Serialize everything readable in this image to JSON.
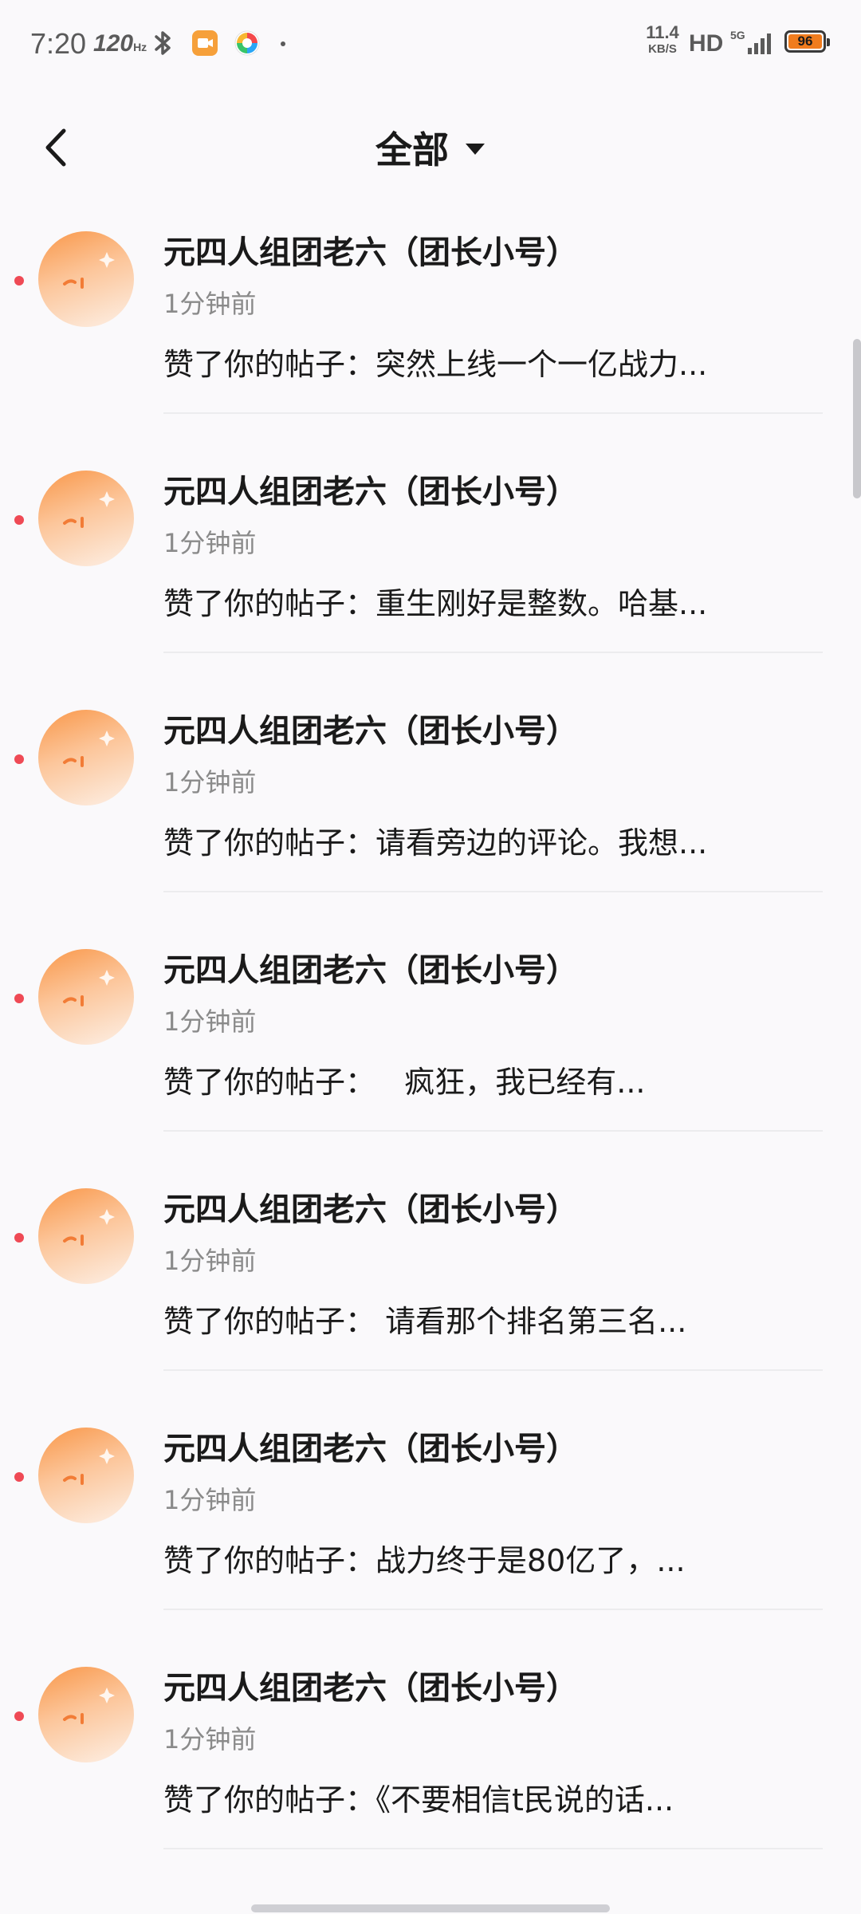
{
  "status_bar": {
    "time": "7:20",
    "refresh_rate": "120",
    "refresh_unit": "Hz",
    "net_speed_value": "11.4",
    "net_speed_unit": "KB/S",
    "hd_label": "HD",
    "network_type": "5G",
    "battery_level": "96",
    "battery_color": "#f07c1e",
    "icons": [
      "bluetooth-icon",
      "screen-record-icon",
      "app-icon",
      "signal-icon",
      "battery-icon"
    ]
  },
  "header": {
    "title": "全部",
    "back_icon": "chevron-left-icon",
    "filter_icon": "caret-down-icon"
  },
  "notifications": [
    {
      "name": "元四人组团老六（团长小号）",
      "time": "1分钟前",
      "message": "赞了你的帖子：突然上线一个一亿战力..."
    },
    {
      "name": "元四人组团老六（团长小号）",
      "time": "1分钟前",
      "message": "赞了你的帖子：重生刚好是整数。哈基..."
    },
    {
      "name": "元四人组团老六（团长小号）",
      "time": "1分钟前",
      "message": "赞了你的帖子：请看旁边的评论。我想..."
    },
    {
      "name": "元四人组团老六（团长小号）",
      "time": "1分钟前",
      "message": "赞了你的帖子：   疯狂，我已经有..."
    },
    {
      "name": "元四人组团老六（团长小号）",
      "time": "1分钟前",
      "message": "赞了你的帖子： 请看那个排名第三名..."
    },
    {
      "name": "元四人组团老六（团长小号）",
      "time": "1分钟前",
      "message": "赞了你的帖子：战力终于是80亿了，..."
    },
    {
      "name": "元四人组团老六（团长小号）",
      "time": "1分钟前",
      "message": "赞了你的帖子：《不要相信t民说的话..."
    }
  ],
  "colors": {
    "unread_dot": "#ef4a55",
    "accent_avatar": "#f99749"
  }
}
